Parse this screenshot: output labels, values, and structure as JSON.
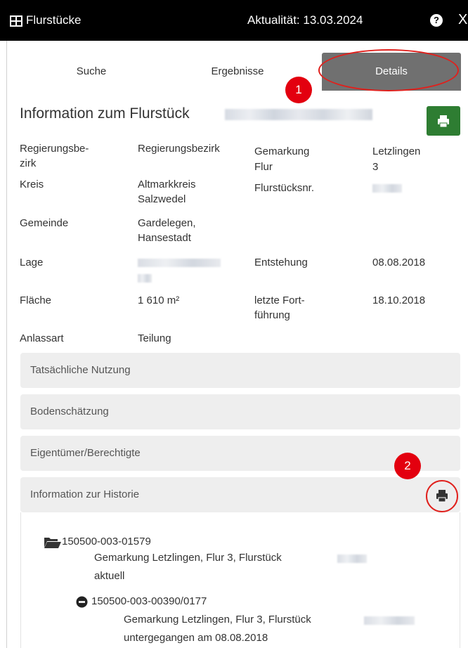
{
  "titlebar": {
    "title": "Flurstücke",
    "aktualitaet": "Aktualität: 13.03.2024",
    "help_glyph": "?",
    "close_glyph": "X"
  },
  "tabs": [
    {
      "label": "Suche"
    },
    {
      "label": "Ergebnisse"
    },
    {
      "label": "Details"
    }
  ],
  "badges": {
    "one": "1",
    "two": "2"
  },
  "info": {
    "title": "Information zum Flurstück",
    "labels": {
      "regierungsbezirk": "Regierungsbe-\nzirk",
      "kreis": "Kreis",
      "gemeinde": "Gemeinde",
      "lage": "Lage",
      "flaeche": "Fläche",
      "anlassart": "Anlassart",
      "gemarkung": "Gemarkung",
      "flur": "Flur",
      "flurstuecksnr": "Flurstücksnr.",
      "entstehung": "Entstehung",
      "letzte_fortfuehrung": "letzte Fort-\nführung"
    },
    "values": {
      "regierungsbezirk": "Regierungsbezirk",
      "kreis": "Altmarkkreis\nSalzwedel",
      "gemeinde": "Gardelegen,\nHansestadt",
      "flaeche": "1 610 m²",
      "anlassart": "Teilung",
      "gemarkung": "Letzlingen",
      "flur": "3",
      "entstehung": "08.08.2018",
      "letzte_fortfuehrung": "18.10.2018"
    }
  },
  "accordions": [
    {
      "label": "Tatsächliche Nutzung"
    },
    {
      "label": "Bodenschätzung"
    },
    {
      "label": "Eigentümer/Berechtigte"
    },
    {
      "label": "Information zur Historie"
    }
  ],
  "history": {
    "root_id": "150500-003-01579",
    "root_desc": "Gemarkung Letzlingen, Flur 3, Flurstück",
    "root_status": "aktuell",
    "child_id": "150500-003-00390/0177",
    "child_desc": "Gemarkung Letzlingen, Flur 3, Flurstück",
    "child_status": "untergegangen am 08.08.2018"
  },
  "colors": {
    "titlebar_bg": "#000000",
    "active_tab_bg": "#707070",
    "print_green": "#2e7d32",
    "highlight_red": "#e0201c",
    "badge_red": "#e3000f",
    "accordion_bg": "#eeeeee"
  },
  "icons": [
    "grid-icon",
    "help-icon",
    "close-icon",
    "printer-icon",
    "folder-open-icon",
    "minus-circle-icon"
  ]
}
